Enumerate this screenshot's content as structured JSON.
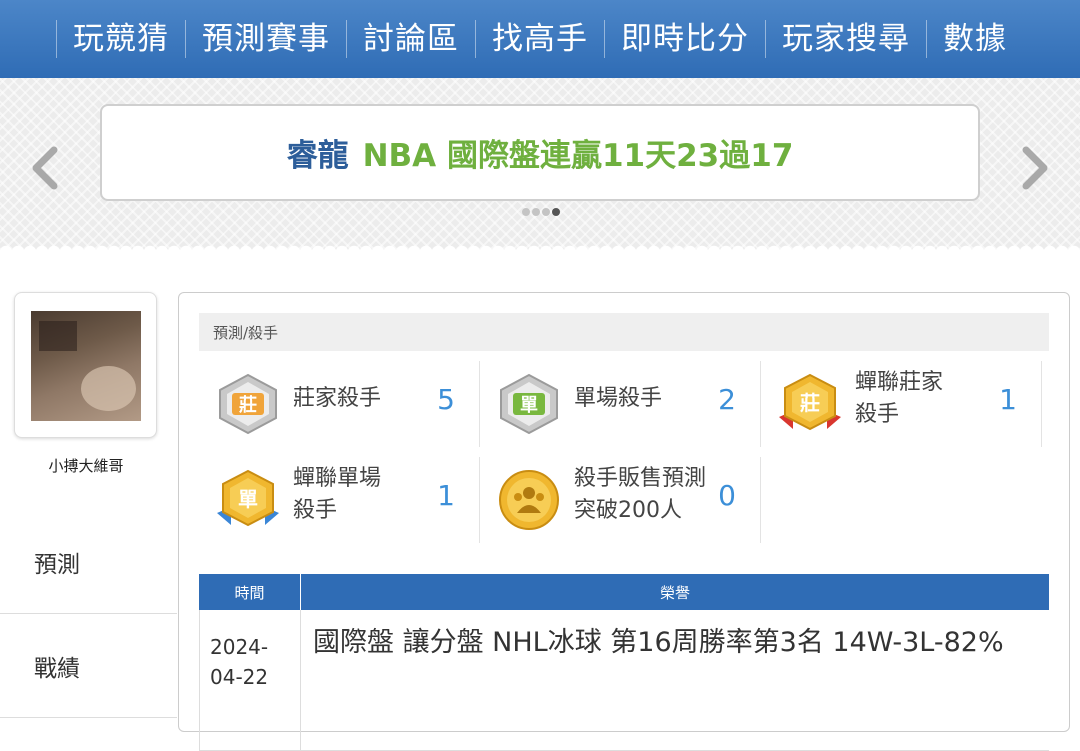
{
  "nav": {
    "items": [
      "玩競猜",
      "預測賽事",
      "討論區",
      "找高手",
      "即時比分",
      "玩家搜尋",
      "數據"
    ]
  },
  "banner": {
    "name": "睿龍",
    "text": "NBA 國際盤連贏11天23過17"
  },
  "user": {
    "name": "小搏大維哥"
  },
  "side_menu": [
    "預測",
    "戰績"
  ],
  "breadcrumb": "預測/殺手",
  "killers": [
    {
      "label_lines": [
        "莊家殺手"
      ],
      "count": "5",
      "icon": "silver-zhuang-badge-icon"
    },
    {
      "label_lines": [
        "單場殺手"
      ],
      "count": "2",
      "icon": "silver-dan-badge-icon"
    },
    {
      "label_lines": [
        "蟬聯莊家",
        "殺手"
      ],
      "count": "1",
      "icon": "gold-zhuang-ribbon-badge-icon"
    },
    {
      "label_lines": [
        "蟬聯單場",
        "殺手"
      ],
      "count": "1",
      "icon": "gold-dan-ribbon-badge-icon"
    },
    {
      "label_lines": [
        "殺手販售預測",
        "突破200人"
      ],
      "count": "0",
      "icon": "gold-people-medal-icon"
    }
  ],
  "icon_text": {
    "zhuang": "莊",
    "dan": "單"
  },
  "table": {
    "headers": {
      "date": "時間",
      "honor": "榮譽"
    },
    "rows": [
      {
        "date_line1": "2024-",
        "date_line2": "04-22",
        "honor": "國際盤 讓分盤 NHL冰球 第16周勝率第3名 14W-3L-82%"
      }
    ]
  },
  "colors": {
    "nav_blue": "#2f6cb5",
    "count_blue": "#3c8fd8",
    "banner_green": "#6fb03f",
    "banner_name": "#2d5e9a"
  }
}
